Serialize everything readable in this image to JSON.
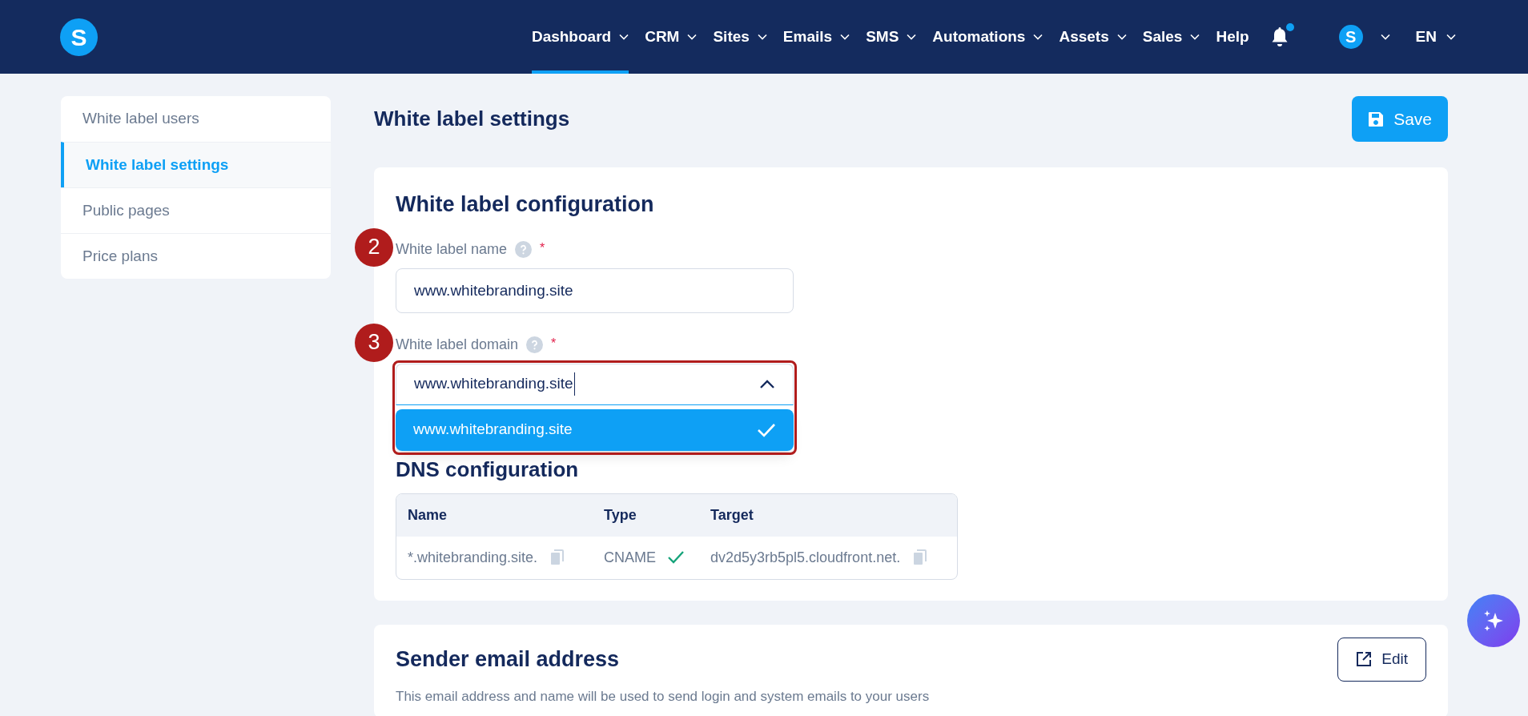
{
  "nav": {
    "logo": "S",
    "items": [
      {
        "label": "Dashboard",
        "selected": true
      },
      {
        "label": "CRM",
        "selected": false
      },
      {
        "label": "Sites",
        "selected": false
      },
      {
        "label": "Emails",
        "selected": false
      },
      {
        "label": "SMS",
        "selected": false
      },
      {
        "label": "Automations",
        "selected": false
      },
      {
        "label": "Assets",
        "selected": false
      },
      {
        "label": "Sales",
        "selected": false
      }
    ],
    "help": "Help",
    "notification": true,
    "avatar": "S",
    "language": "EN"
  },
  "sidebar": {
    "items": [
      {
        "label": "White label users",
        "selected": false
      },
      {
        "label": "White label settings",
        "selected": true
      },
      {
        "label": "Public pages",
        "selected": false
      },
      {
        "label": "Price plans",
        "selected": false
      }
    ]
  },
  "page_title": "White label settings",
  "save_button": "Save",
  "config_card": {
    "title": "White label configuration",
    "fields": [
      {
        "kind": "text",
        "step": "2",
        "label": "White label name",
        "required": "*",
        "value": "www.whitebranding.site"
      },
      {
        "kind": "select",
        "step": "3",
        "label": "White label domain",
        "required": "*",
        "value": "www.whitebranding.site",
        "expanded": true,
        "highlighted": true,
        "options": [
          {
            "label": "www.whitebranding.site",
            "selected": true
          }
        ]
      }
    ],
    "dns_title": "DNS configuration",
    "table": {
      "columns": [
        "Name",
        "Type",
        "Target"
      ],
      "rows": [
        {
          "name": "*.whitebranding.site.",
          "type": "CNAME",
          "verified": true,
          "target": "dv2d5y3rb5pl5.cloudfront.net."
        }
      ]
    }
  },
  "sender_card": {
    "title": "Sender email address",
    "edit_button": "Edit",
    "description": "This email address and name will be used to send login and system emails to your users"
  }
}
